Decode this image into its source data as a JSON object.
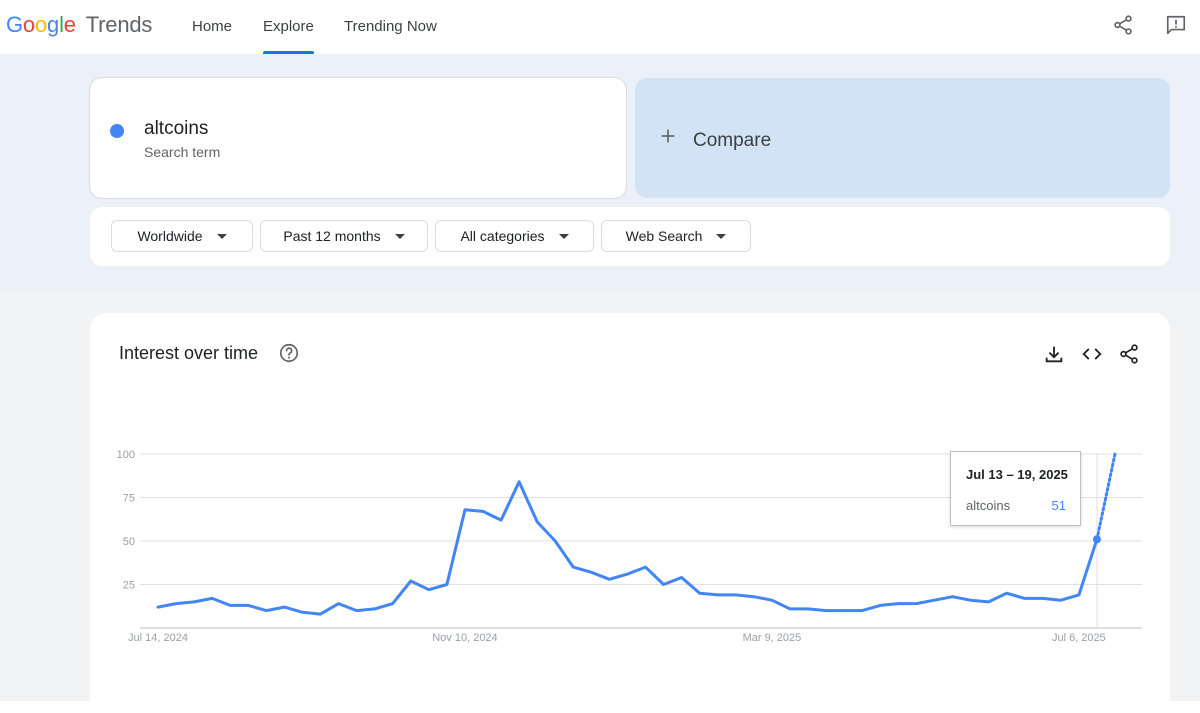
{
  "header": {
    "logo": {
      "google": "Google",
      "trends": "Trends"
    },
    "nav": [
      {
        "label": "Home",
        "active": false
      },
      {
        "label": "Explore",
        "active": true
      },
      {
        "label": "Trending Now",
        "active": false
      }
    ],
    "icons": [
      "share-icon",
      "feedback-icon"
    ]
  },
  "search": {
    "term": "altcoins",
    "subtitle": "Search term",
    "term_color": "#4285f4",
    "compare_label": "Compare"
  },
  "filters": {
    "region": "Worldwide",
    "time": "Past 12 months",
    "category": "All categories",
    "property": "Web Search"
  },
  "chart": {
    "title": "Interest over time",
    "actions": [
      "download-icon",
      "embed-icon",
      "share-icon"
    ],
    "tooltip": {
      "date": "Jul 13 – 19, 2025",
      "term": "altcoins",
      "value": "51"
    }
  },
  "chart_data": {
    "type": "line",
    "ylim": [
      0,
      100
    ],
    "yticks": [
      25,
      50,
      75,
      100
    ],
    "xtick_labels": [
      "Jul 14, 2024",
      "Nov 10, 2024",
      "Mar 9, 2025",
      "Jul 6, 2025"
    ],
    "xtick_index": [
      0,
      17,
      34,
      51
    ],
    "grid": true,
    "partial_last_point": true,
    "series": [
      {
        "name": "altcoins",
        "color": "#4285f4",
        "values": [
          12,
          14,
          15,
          17,
          13,
          13,
          10,
          12,
          9,
          8,
          14,
          10,
          11,
          14,
          27,
          22,
          25,
          68,
          67,
          62,
          84,
          61,
          50,
          35,
          32,
          28,
          31,
          35,
          25,
          29,
          20,
          19,
          19,
          18,
          16,
          11,
          11,
          10,
          10,
          10,
          13,
          14,
          14,
          16,
          18,
          16,
          15,
          20,
          17,
          17,
          16,
          19,
          51,
          100
        ]
      }
    ]
  }
}
